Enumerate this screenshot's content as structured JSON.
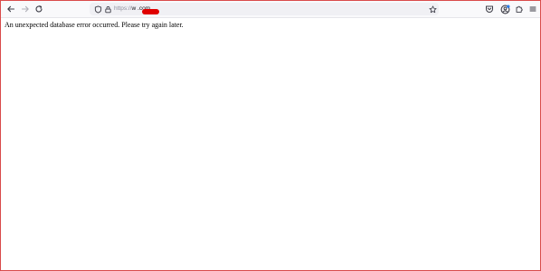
{
  "browser": {
    "url_scheme": "https://",
    "url_host": "w       .com"
  },
  "page": {
    "error_message": "An unexpected database error occurred. Please try again later."
  },
  "icons": [
    "back-icon",
    "forward-icon",
    "reload-icon",
    "shield-icon",
    "lock-icon",
    "star-icon",
    "pocket-icon",
    "account-icon",
    "extensions-icon",
    "menu-icon"
  ],
  "colors": {
    "frame_border": "#d94b4b",
    "redaction": "#e00000",
    "toolbar_bg": "#f9f9fb",
    "urlbar_bg": "#f0f0f4"
  }
}
